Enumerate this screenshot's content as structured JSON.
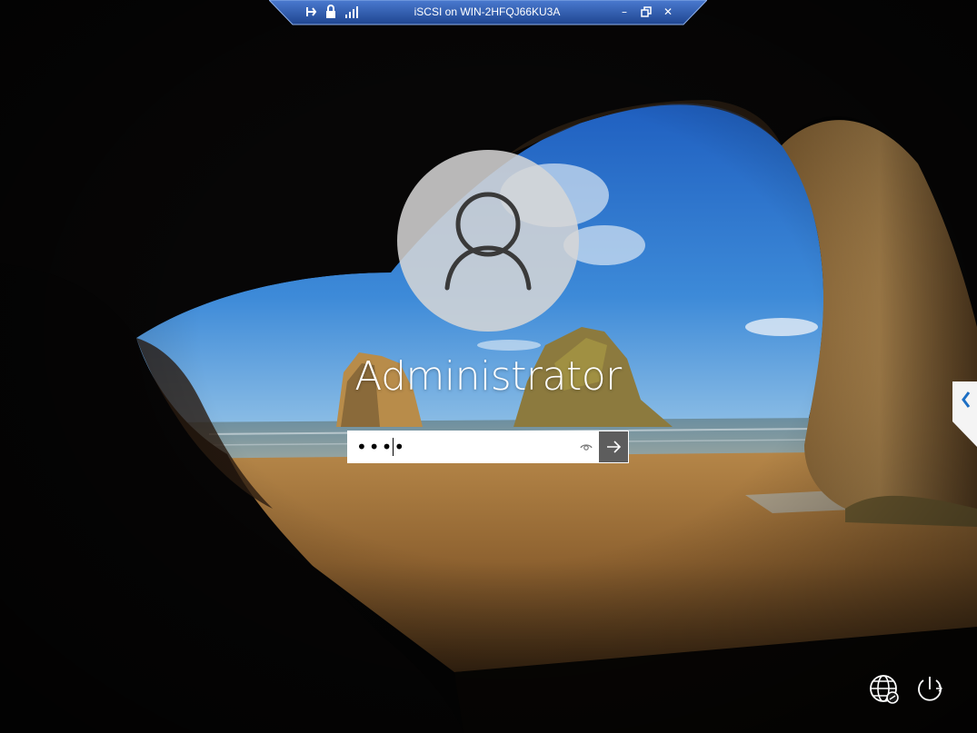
{
  "rdp_bar": {
    "title": "iSCSI on WIN-2HFQJ66KU3A",
    "pin_icon": "pin-icon",
    "lock_icon": "lock-icon",
    "signal_icon": "signal-strength-icon",
    "minimize_label": "–",
    "restore_icon": "restore-icon",
    "close_label": "✕"
  },
  "login": {
    "username": "Administrator",
    "password_value": "••••",
    "reveal_icon": "eye-icon",
    "submit_icon": "arrow-right-icon"
  },
  "bottom_right": {
    "network_icon": "network-globe-icon",
    "power_icon": "power-icon"
  },
  "colors": {
    "rdp_bar": "#2f5aa8",
    "avatar": "#d6d6d6",
    "submit": "#5d5d5d",
    "side_tab_arrow": "#1d6fc4"
  }
}
